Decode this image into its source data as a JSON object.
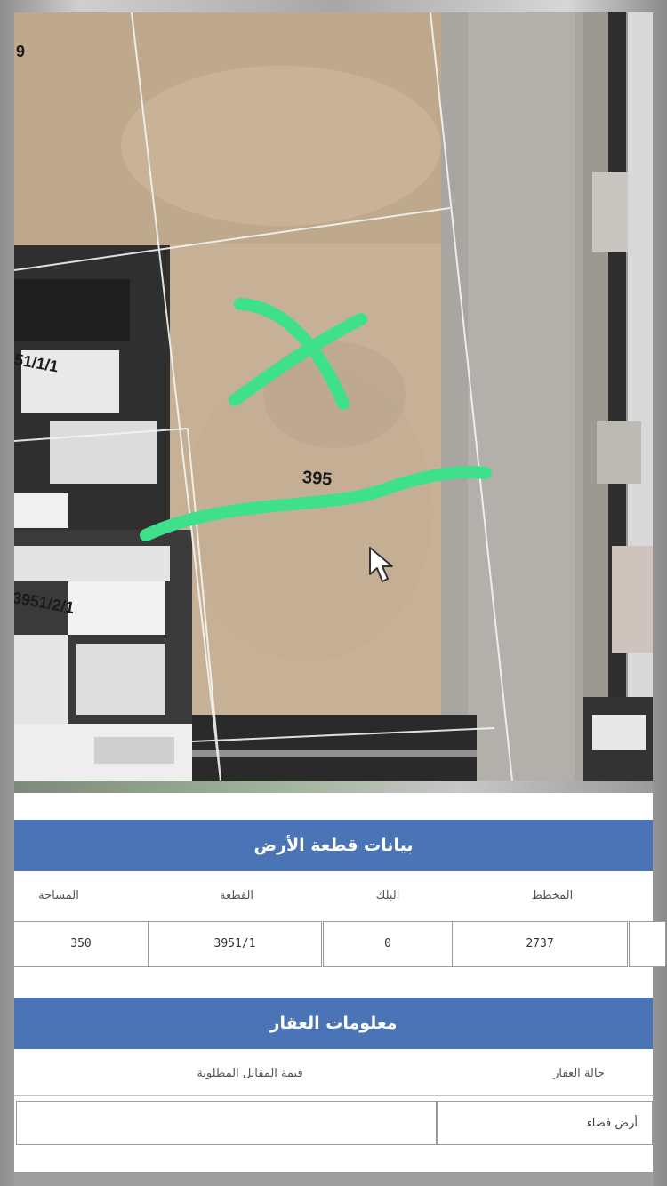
{
  "map": {
    "plot_labels": {
      "top_left_partial": "9",
      "west_upper": "51/1/1",
      "subject_plot": "395",
      "west_lower": "3951/2/1"
    },
    "markings": {
      "cross_mark": "green-x-mark",
      "boundary_line": "green-underline-mark",
      "cursor": "arrow-cursor-icon"
    },
    "colors": {
      "marker_green": "#3ee08c",
      "parcel_line": "#ffffff"
    }
  },
  "land_section": {
    "title": "بيانات قطعة الأرض",
    "headers": {
      "area": "المساحة",
      "parcel": "القطعة",
      "block": "البلك",
      "scheme": "المخطط"
    },
    "values": {
      "area": "350",
      "parcel": "3951/1",
      "block": "0",
      "scheme": "2737"
    }
  },
  "property_section": {
    "title": "معلومات العقار",
    "headers": {
      "status": "حالة العقار",
      "price": "قيمة المقابل المطلوبة"
    },
    "values": {
      "status": "أرض فضاء",
      "price": ""
    }
  },
  "colors": {
    "header_bar": "#4a74b6"
  }
}
